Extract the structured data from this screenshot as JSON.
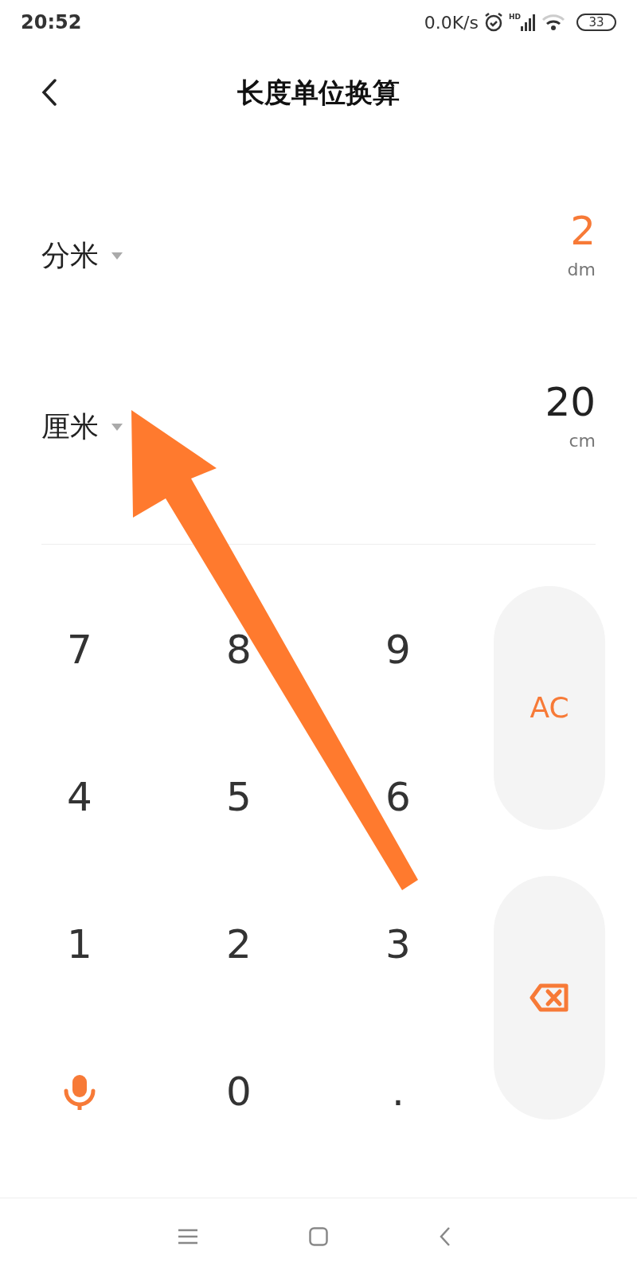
{
  "status_bar": {
    "time": "20:52",
    "speed": "0.0K/s",
    "network": "HD",
    "battery": "33"
  },
  "header": {
    "title": "长度单位换算"
  },
  "conversions": [
    {
      "unit_name": "分米",
      "value": "2",
      "unit": "dm",
      "selected": true
    },
    {
      "unit_name": "厘米",
      "value": "20",
      "unit": "cm",
      "selected": false
    }
  ],
  "keypad": [
    {
      "kind": "digit",
      "label": "7"
    },
    {
      "kind": "digit",
      "label": "8"
    },
    {
      "kind": "digit",
      "label": "9"
    },
    {
      "kind": "digit",
      "label": "4"
    },
    {
      "kind": "digit",
      "label": "5"
    },
    {
      "kind": "digit",
      "label": "6"
    },
    {
      "kind": "digit",
      "label": "1"
    },
    {
      "kind": "digit",
      "label": "2"
    },
    {
      "kind": "digit",
      "label": "3"
    },
    {
      "kind": "mic"
    },
    {
      "kind": "digit",
      "label": "0"
    },
    {
      "kind": "digit",
      "label": "."
    }
  ],
  "side_keys": [
    {
      "kind": "clear",
      "label": "AC"
    },
    {
      "kind": "backspace"
    }
  ]
}
